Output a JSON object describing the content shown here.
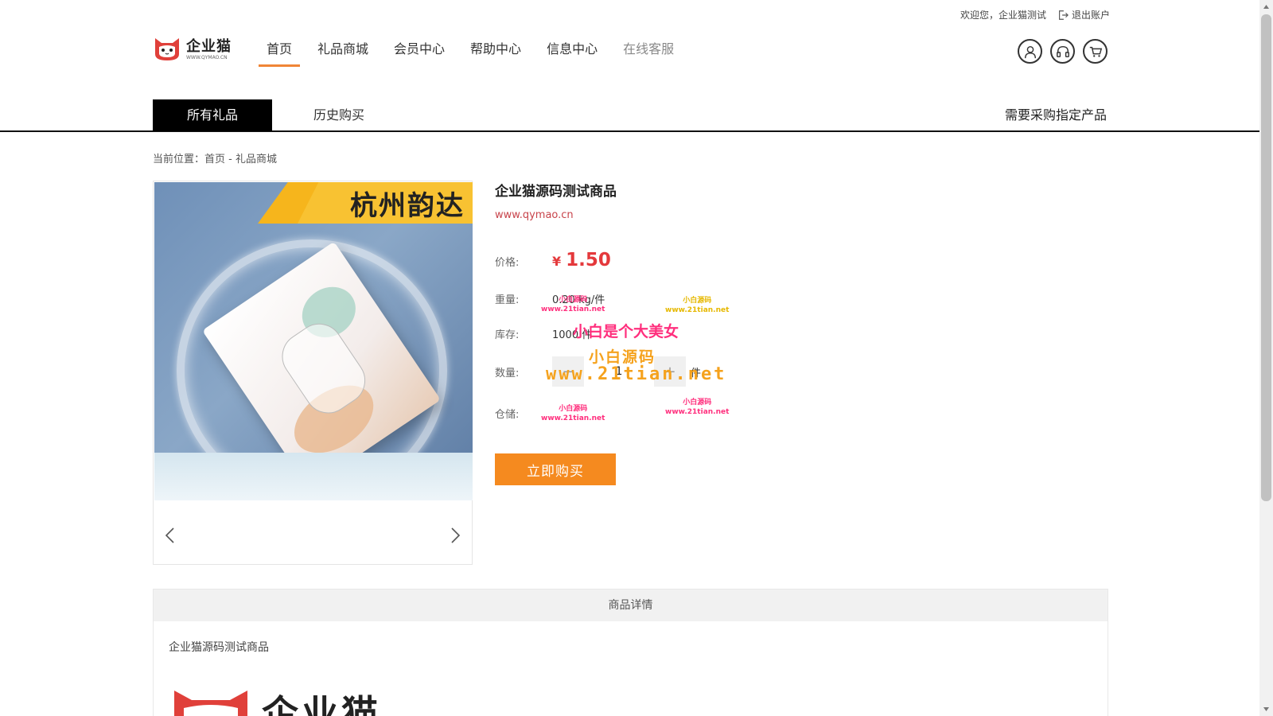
{
  "topbar": {
    "welcome": "欢迎您，企业猫测试",
    "logout": "退出账户"
  },
  "logo": {
    "name": "企业猫",
    "url": "WWW.QYMAO.CN"
  },
  "nav": [
    {
      "label": "首页",
      "active": true
    },
    {
      "label": "礼品商城",
      "active": false
    },
    {
      "label": "会员中心",
      "active": false
    },
    {
      "label": "帮助中心",
      "active": false
    },
    {
      "label": "信息中心",
      "active": false
    },
    {
      "label": "在线客服",
      "active": false
    }
  ],
  "header_icons": [
    "user-icon",
    "headset-icon",
    "cart-icon"
  ],
  "subtabs": {
    "all": "所有礼品",
    "history": "历史购买",
    "need": "需要采购指定产品"
  },
  "breadcrumb": {
    "prefix": "当前位置：",
    "home": "首页",
    "sep": " - ",
    "current": "礼品商城"
  },
  "product": {
    "image_banner": "杭州韵达",
    "name": "企业猫源码测试商品",
    "site": "www.qymao.cn",
    "price_label": "价格:",
    "currency": "¥",
    "price": "1.50",
    "weight_label": "重量:",
    "weight": "0.20 kg/件",
    "stock_label": "库存:",
    "stock": "1000 件",
    "qty_label": "数量:",
    "qty": "1",
    "qty_unit": "件",
    "warehouse_label": "仓储:",
    "buy_button": "立即购买"
  },
  "watermark": {
    "line1": "小白是个大美女",
    "line2": "小白源码",
    "line3": "www.21tian.net",
    "small_name": "小白源码",
    "small_url": "www.21tian.net"
  },
  "detail": {
    "title": "商品详情",
    "text": "企业猫源码测试商品",
    "logo_text": "企业猫"
  },
  "colors": {
    "accent": "#f08536",
    "price": "#e4393c",
    "buy": "#f58a1f",
    "site": "#c8444b"
  }
}
